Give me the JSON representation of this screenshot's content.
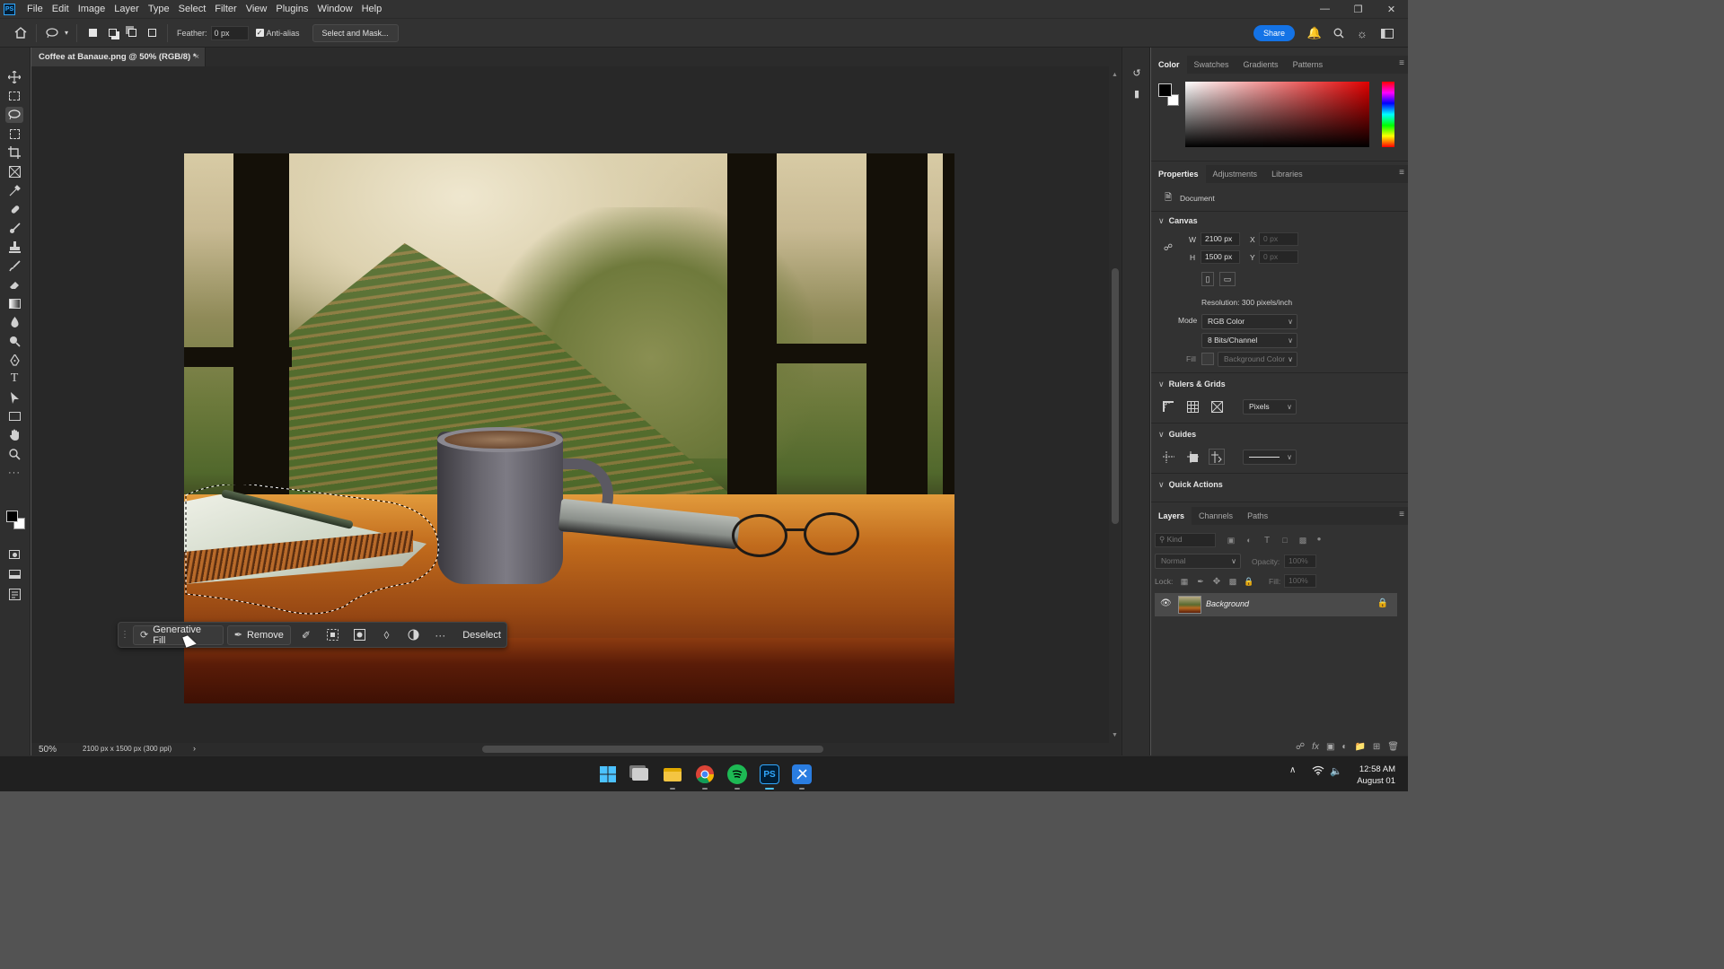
{
  "menubar": {
    "app_icon": "PS",
    "items": [
      "File",
      "Edit",
      "Image",
      "Layer",
      "Type",
      "Select",
      "Filter",
      "View",
      "Plugins",
      "Window",
      "Help"
    ]
  },
  "options_bar": {
    "feather_label": "Feather:",
    "feather_value": "0 px",
    "anti_alias_label": "Anti-alias",
    "anti_alias_checked": true,
    "select_mask_label": "Select and Mask...",
    "share_label": "Share"
  },
  "document": {
    "tab_title": "Coffee at Banaue.png @ 50% (RGB/8) *",
    "close_glyph": "×"
  },
  "context_taskbar": {
    "generative_fill_label": "Generative Fill",
    "remove_label": "Remove",
    "deselect_label": "Deselect"
  },
  "statusbar": {
    "zoom": "50%",
    "dimensions": "2100 px x 1500 px (300 ppi)"
  },
  "color_panel": {
    "tabs": [
      "Color",
      "Swatches",
      "Gradients",
      "Patterns"
    ],
    "foreground": "#000000",
    "background": "#ffffff"
  },
  "properties_panel": {
    "tabs": [
      "Properties",
      "Adjustments",
      "Libraries"
    ],
    "document_label": "Document",
    "canvas_title": "Canvas",
    "w_label": "W",
    "w_value": "2100 px",
    "h_label": "H",
    "h_value": "1500 px",
    "x_label": "X",
    "x_value": "0 px",
    "y_label": "Y",
    "y_value": "0 px",
    "resolution": "Resolution: 300 pixels/inch",
    "mode_label": "Mode",
    "mode_value": "RGB Color",
    "bits_value": "8 Bits/Channel",
    "fill_label": "Fill",
    "fill_value": "Background Color",
    "rulers_title": "Rulers & Grids",
    "units_value": "Pixels",
    "guides_title": "Guides",
    "quick_actions_title": "Quick Actions"
  },
  "layers_panel": {
    "tabs": [
      "Layers",
      "Channels",
      "Paths"
    ],
    "kind_placeholder": "Kind",
    "blend_mode": "Normal",
    "opacity_label": "Opacity:",
    "opacity_value": "100%",
    "lock_label": "Lock:",
    "fill_label": "Fill:",
    "fill_value": "100%",
    "layers": [
      {
        "name": "Background",
        "visible": true,
        "locked": true
      }
    ]
  },
  "system": {
    "time": "12:58 AM",
    "date": "August 01"
  },
  "colors": {
    "accent": "#1473e6",
    "chrome": "#323232",
    "canvas_bg": "#282828"
  }
}
